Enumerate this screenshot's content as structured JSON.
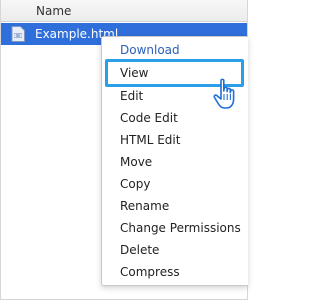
{
  "header": {
    "column_name": "Name"
  },
  "file": {
    "name": "Example.html",
    "icon": "html-file-icon"
  },
  "menu": {
    "items": [
      {
        "label": "Download"
      },
      {
        "label": "View"
      },
      {
        "label": "Edit"
      },
      {
        "label": "Code Edit"
      },
      {
        "label": "HTML Edit"
      },
      {
        "label": "Move"
      },
      {
        "label": "Copy"
      },
      {
        "label": "Rename"
      },
      {
        "label": "Change Permissions"
      },
      {
        "label": "Delete"
      },
      {
        "label": "Compress"
      }
    ],
    "highlighted": "View"
  },
  "colors": {
    "selection": "#2f6fdb",
    "highlight_border": "#2a9fe8",
    "download_text": "#2c5fb8"
  }
}
